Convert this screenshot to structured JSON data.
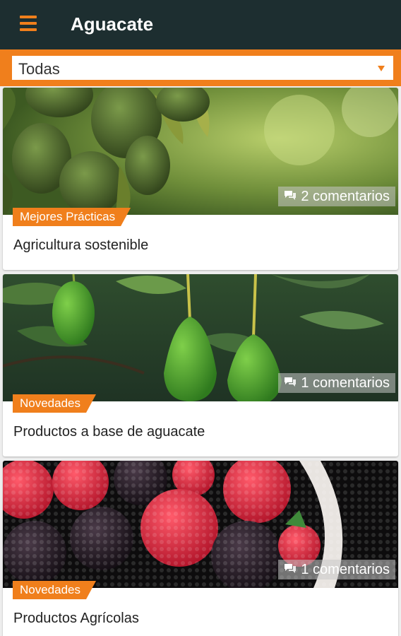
{
  "header": {
    "title": "Aguacate",
    "menu_icon": "hamburger-menu-icon",
    "background": "#1d2e30",
    "accent": "#f07f1c"
  },
  "filter": {
    "selected": "Todas"
  },
  "posts": [
    {
      "title": "Agricultura sostenible",
      "category": "Mejores Prácticas",
      "comments": "2 comentarios",
      "image": "avocados-on-tree"
    },
    {
      "title": "Productos a base de aguacate",
      "category": "Novedades",
      "comments": "1 comentarios",
      "image": "green-avocados-hanging"
    },
    {
      "title": "Productos Agrícolas",
      "category": "Novedades",
      "comments": "1 comentarios",
      "image": "raspberries-and-blackberries"
    }
  ]
}
